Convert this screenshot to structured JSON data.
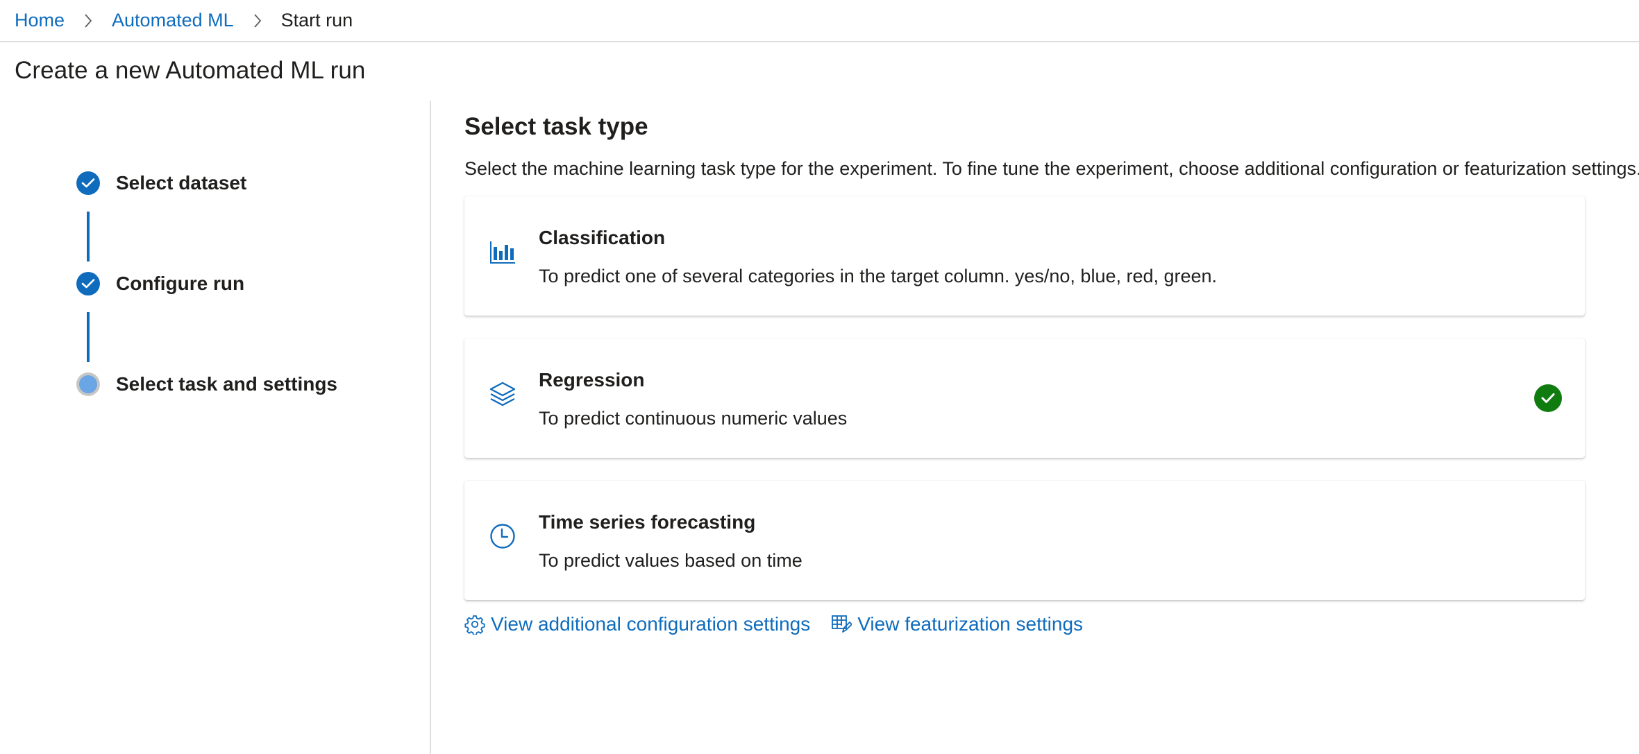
{
  "breadcrumb": {
    "items": [
      {
        "label": "Home",
        "link": true
      },
      {
        "label": "Automated ML",
        "link": true
      },
      {
        "label": "Start run",
        "link": false
      }
    ]
  },
  "page": {
    "title": "Create a new Automated ML run"
  },
  "wizard": {
    "steps": [
      {
        "label": "Select dataset",
        "state": "completed"
      },
      {
        "label": "Configure run",
        "state": "completed"
      },
      {
        "label": "Select task and settings",
        "state": "current"
      }
    ]
  },
  "main": {
    "title": "Select task type",
    "description": "Select the machine learning task type for the experiment. To fine tune the experiment, choose additional configuration or featurization settings.",
    "tasks": [
      {
        "title": "Classification",
        "description": "To predict one of several categories in the target column. yes/no, blue, red, green.",
        "icon": "bar-chart-icon",
        "selected": false
      },
      {
        "title": "Regression",
        "description": "To predict continuous numeric values",
        "icon": "layers-icon",
        "selected": true
      },
      {
        "title": "Time series forecasting",
        "description": "To predict values based on time",
        "icon": "clock-icon",
        "selected": false
      }
    ],
    "links": {
      "config_label": "View additional configuration settings",
      "featurization_label": "View featurization settings"
    }
  },
  "colors": {
    "accent": "#0f6cbd",
    "success": "#107c10",
    "step_current": "#6aa6e6",
    "divider": "#e1dfdd"
  }
}
